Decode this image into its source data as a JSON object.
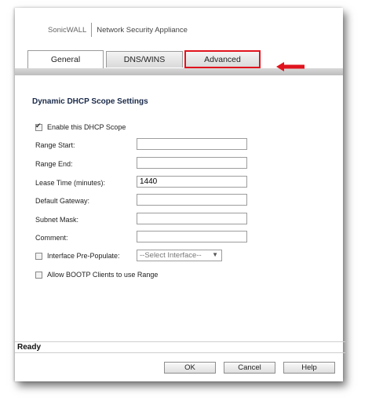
{
  "header": {
    "company": "SonicWALL",
    "product": "Network Security Appliance"
  },
  "tabs": [
    {
      "label": "General",
      "active": true
    },
    {
      "label": "DNS/WINS",
      "active": false
    },
    {
      "label": "Advanced",
      "active": false,
      "highlighted": true
    }
  ],
  "annotation": {
    "arrow_color": "#e0141e"
  },
  "section": {
    "title": "Dynamic DHCP Scope Settings"
  },
  "form": {
    "enable_scope": {
      "label": "Enable this DHCP Scope",
      "checked": true
    },
    "range_start": {
      "label": "Range Start:",
      "value": ""
    },
    "range_end": {
      "label": "Range End:",
      "value": ""
    },
    "lease_time": {
      "label": "Lease Time (minutes):",
      "value": "1440"
    },
    "default_gateway": {
      "label": "Default Gateway:",
      "value": ""
    },
    "subnet_mask": {
      "label": "Subnet Mask:",
      "value": ""
    },
    "comment": {
      "label": "Comment:",
      "value": ""
    },
    "interface_prepopulate": {
      "label": "Interface Pre-Populate:",
      "checked": false,
      "selected": "--Select Interface--"
    },
    "allow_bootp": {
      "label": "Allow BOOTP Clients to use Range",
      "checked": false
    }
  },
  "status": {
    "text": "Ready"
  },
  "buttons": {
    "ok": "OK",
    "cancel": "Cancel",
    "help": "Help"
  }
}
